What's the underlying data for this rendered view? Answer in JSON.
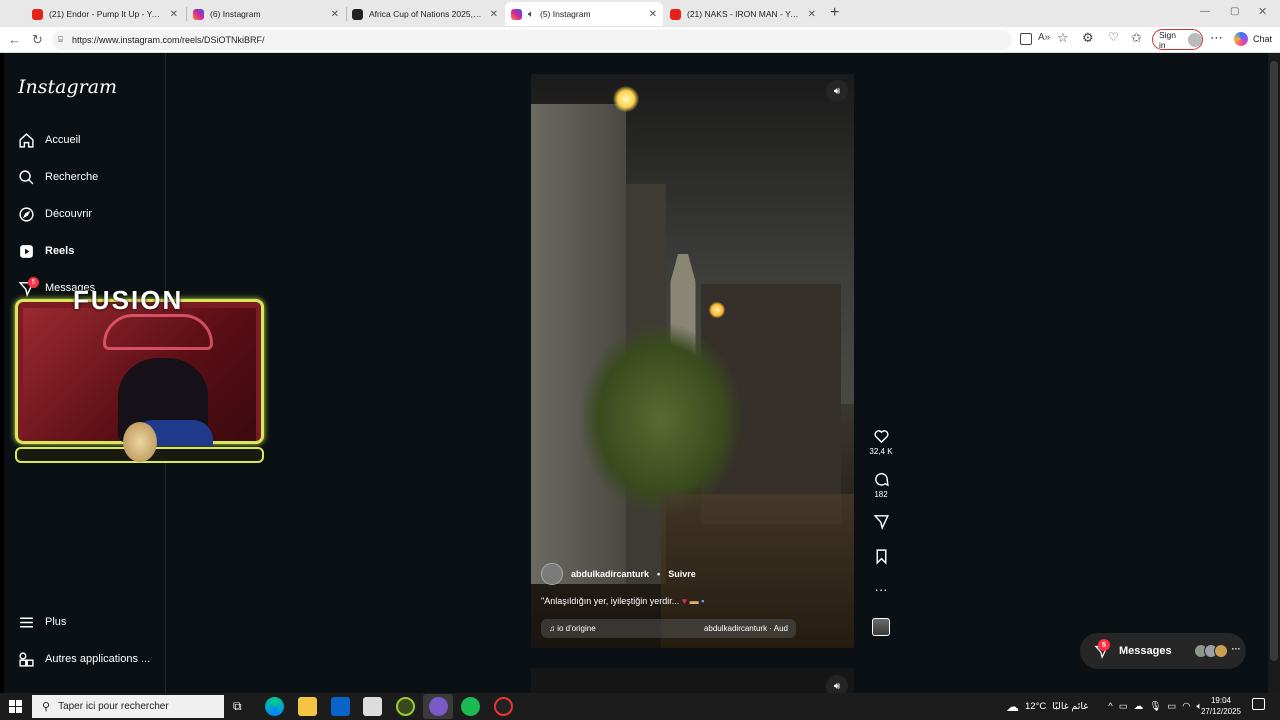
{
  "browser": {
    "tabs": [
      {
        "title": "(21) Endor - Pump It Up - YouTube",
        "favicon_color": "#e62117"
      },
      {
        "title": "(6) Instagram",
        "favicon_color": "#d6249f"
      },
      {
        "title": "Africa Cup of Nations 2025, Footb",
        "favicon_color": "#222222"
      },
      {
        "title": "(5) Instagram",
        "favicon_color": "#d6249f"
      },
      {
        "title": "(21) NAKS - IRON MAN - YouTube",
        "favicon_color": "#e62117"
      }
    ],
    "url": "https://www.instagram.com/reels/DSiOTNkiBRF/",
    "sign_in_label": "Sign in",
    "chat_label": "Chat"
  },
  "sidebar": {
    "logo": "Instagram",
    "items": [
      {
        "label": "Accueil",
        "icon": "home-icon"
      },
      {
        "label": "Recherche",
        "icon": "search-icon"
      },
      {
        "label": "Découvrir",
        "icon": "compass-icon"
      },
      {
        "label": "Reels",
        "icon": "reels-icon"
      },
      {
        "label": "Messages",
        "icon": "messenger-icon",
        "badge": "5"
      }
    ],
    "bottom_items": [
      {
        "label": "Plus",
        "icon": "menu-icon"
      },
      {
        "label": "Autres applications ...",
        "icon": "apps-icon"
      }
    ]
  },
  "overlay": {
    "title": "FUSION"
  },
  "reel": {
    "author": "abdulkadircanturk",
    "separator": "•",
    "follow_label": "Suivre",
    "caption": "\"Anlaşıldığın yer, iyileştiğin yerdir...",
    "audio_left": "io d'origine",
    "audio_right": "abdulkadircanturk · Aud",
    "likes": "32,4 K",
    "comments": "182"
  },
  "messages_pill": {
    "label": "Messages",
    "badge": "5"
  },
  "taskbar": {
    "search_placeholder": "Taper ici pour rechercher",
    "weather": "12°C",
    "weather_desc": "غائم غالبًا",
    "time": "19:04",
    "date": "27/12/2025"
  },
  "colors": {
    "instagram_bg": "#0b1014",
    "notification_badge": "#ff3040",
    "overlay_accent": "#d8e85a"
  }
}
